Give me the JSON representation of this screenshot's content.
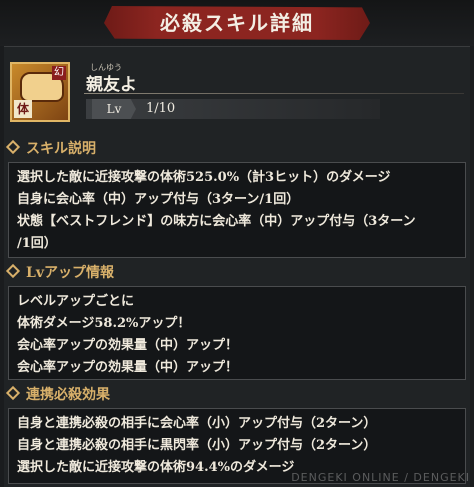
{
  "header": {
    "title": "必殺スキル詳細"
  },
  "skill": {
    "icon_corner": "幻",
    "icon_kanji": "体",
    "name_ruby": "しんゆう",
    "name": "親友よ",
    "lv_label": "Lv",
    "lv_value": "1/10"
  },
  "sections": {
    "skill_desc": {
      "title": "スキル説明",
      "lines": [
        "選択した敵に近接攻撃の体術525.0%（計3ヒット）のダメージ",
        "自身に会心率（中）アップ付与（3ターン/1回）",
        "状態【ベストフレンド】の味方に会心率（中）アップ付与（3ターン",
        "/1回）"
      ]
    },
    "lv_up": {
      "title": "Lvアップ情報",
      "lines": [
        "レベルアップごとに",
        "体術ダメージ58.2%アップ！",
        "会心率アップの効果量（中）アップ！",
        "会心率アップの効果量（中）アップ！"
      ]
    },
    "combo": {
      "title": "連携必殺効果",
      "lines": [
        "自身と連携必殺の相手に会心率（小）アップ付与（2ターン）",
        "自身と連携必殺の相手に黒閃率（小）アップ付与（2ターン）",
        "選択した敵に近接攻撃の体術94.4%のダメージ"
      ]
    }
  },
  "watermark": "DENGEKI ONLINE / DENGEKI"
}
